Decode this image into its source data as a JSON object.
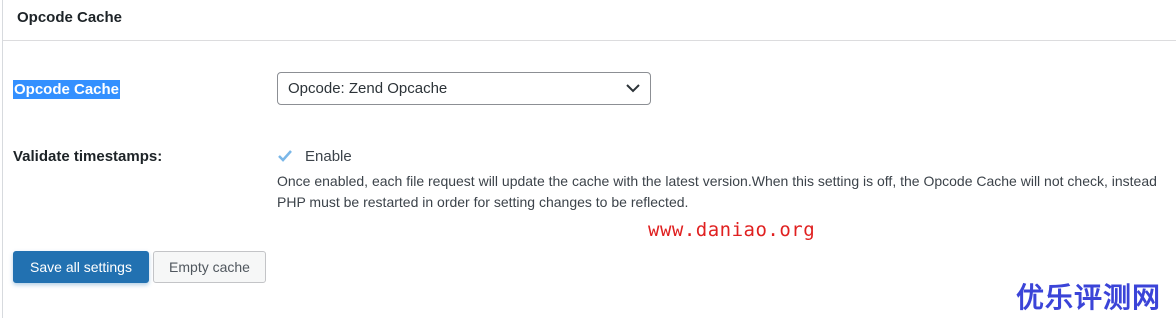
{
  "panel": {
    "title": "Opcode Cache"
  },
  "opcode_row": {
    "label": "Opcode Cache",
    "select_value": "Opcode: Zend Opcache"
  },
  "validate_row": {
    "label": "Validate timestamps:",
    "checkbox_checked": true,
    "checkbox_label": "Enable",
    "description": "Once enabled, each file request will update the cache with the latest version.When this setting is off, the Opcode Cache will not check, instead PHP must be restarted in order for setting changes to be reflected."
  },
  "buttons": {
    "save_label": "Save all settings",
    "empty_label": "Empty cache"
  },
  "watermarks": {
    "url": "www.daniao.org",
    "site_name": "优乐评测网"
  },
  "colors": {
    "primary": "#2271b1",
    "selection": "#3390ff",
    "check": "#7ab7e8",
    "watermark_url": "#e02020",
    "watermark_cn": "#3b44d8"
  }
}
